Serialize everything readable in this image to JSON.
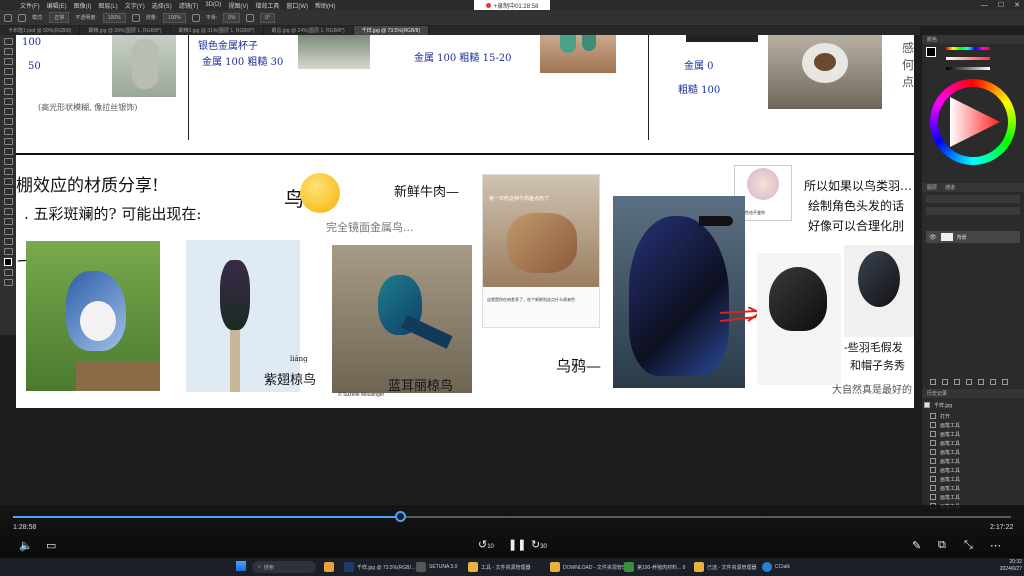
{
  "menubar": {
    "items": [
      "文件(F)",
      "编辑(E)",
      "图像(I)",
      "图层(L)",
      "文字(Y)",
      "选择(S)",
      "滤镜(T)",
      "3D(D)",
      "视图(V)",
      "增效工具",
      "窗口(W)",
      "帮助(H)"
    ],
    "recording": "+录制中01:28:58"
  },
  "optbar": {
    "mode_label": "模式:",
    "mode_value": "正常",
    "opacity_label": "不透明度:",
    "opacity_value": "100%",
    "flow_label": "流量:",
    "flow_value": "100%",
    "smooth_label": "平滑:",
    "smooth_value": "0%",
    "angle_value": "0°"
  },
  "doctabs": [
    {
      "label": "卡布隆1.psd @ 50%(RGB/8)",
      "active": false
    },
    {
      "label": "霸精.jpg @ 29%(图层 1, RGB/8*)",
      "active": false
    },
    {
      "label": "霸精2.jpg @ 31%(图层 1, RGB/8*)",
      "active": false
    },
    {
      "label": "霸总.jpg @ 24%(图层 1, RGB/8*)",
      "active": false
    },
    {
      "label": "千样.jpg @ 73.5%(RGB/8)",
      "active": true
    }
  ],
  "canvas": {
    "top_notes": {
      "n100": "100",
      "n50": "50",
      "caption_left": "(高光形状模糊, 像拉丝银饰)",
      "metal_title": "银色金属杯子",
      "metal_values": "金属 100 粗糙 30",
      "metal2_values": "金属 100 粗糙 15-20",
      "right_metal": "金属 0",
      "right_rough": "粗糙 100"
    },
    "heading1": "棚效应的材质分享!",
    "heading2": ". 五彩斑斓的? 可能出现在:",
    "bird_char": "鸟",
    "mirror_metal_label": "完全镜面金属鸟...",
    "fresh_beef": "新鲜牛肉—",
    "crow_label": "乌鸦—",
    "starling_pinyin": "liáng",
    "starling_label": "紫翅椋鸟",
    "glossy_label": "蓝耳丽椋鸟",
    "photo_credit": "© Suzelle Mousinger",
    "comment_popup_title": "第一次吃这种牛肉差点扔了",
    "comment_text": "这就是你在肉差多了，吃个新鲜别这点什么原来色",
    "meme_caption": "我看色也不变你",
    "right_notes": [
      "所以如果以鸟类羽…",
      "绘制角色头发的话",
      "好像可以合理化刖"
    ],
    "feather_note": [
      "-些羽毛假发",
      "和帽子务秀"
    ],
    "bottom_note": "大自然真是最好的"
  },
  "history": {
    "panel_title": "历史记录",
    "file": "千样.jpg",
    "items": [
      "打开",
      "画笔工具",
      "画笔工具",
      "画笔工具",
      "画笔工具",
      "画笔工具",
      "画笔工具",
      "画笔工具",
      "画笔工具",
      "画笔工具",
      "画笔工具"
    ]
  },
  "layers": {
    "tabs": [
      "图层",
      "通道"
    ],
    "layer_name": "背景"
  },
  "color_panel": {
    "tabs": [
      "颜色"
    ]
  },
  "video": {
    "current_time": "1:28:58",
    "total_time": "2:17:22",
    "progress": 0.388,
    "rewind_label": "10",
    "forward_label": "30"
  },
  "taskbar": {
    "search_placeholder": "搜索",
    "apps": [
      "千样.jpg @ 73.5%(RGB/...",
      "SETUNA 3.0",
      "工具 - 文件资源管理器",
      "DOWNLOAD - 文件资源管理器",
      "第190-养殖肉材料... 9",
      "已选 - 文件资源管理器",
      "CCtalk"
    ],
    "clock_time": "20:32",
    "clock_date": "2024/6/27"
  }
}
